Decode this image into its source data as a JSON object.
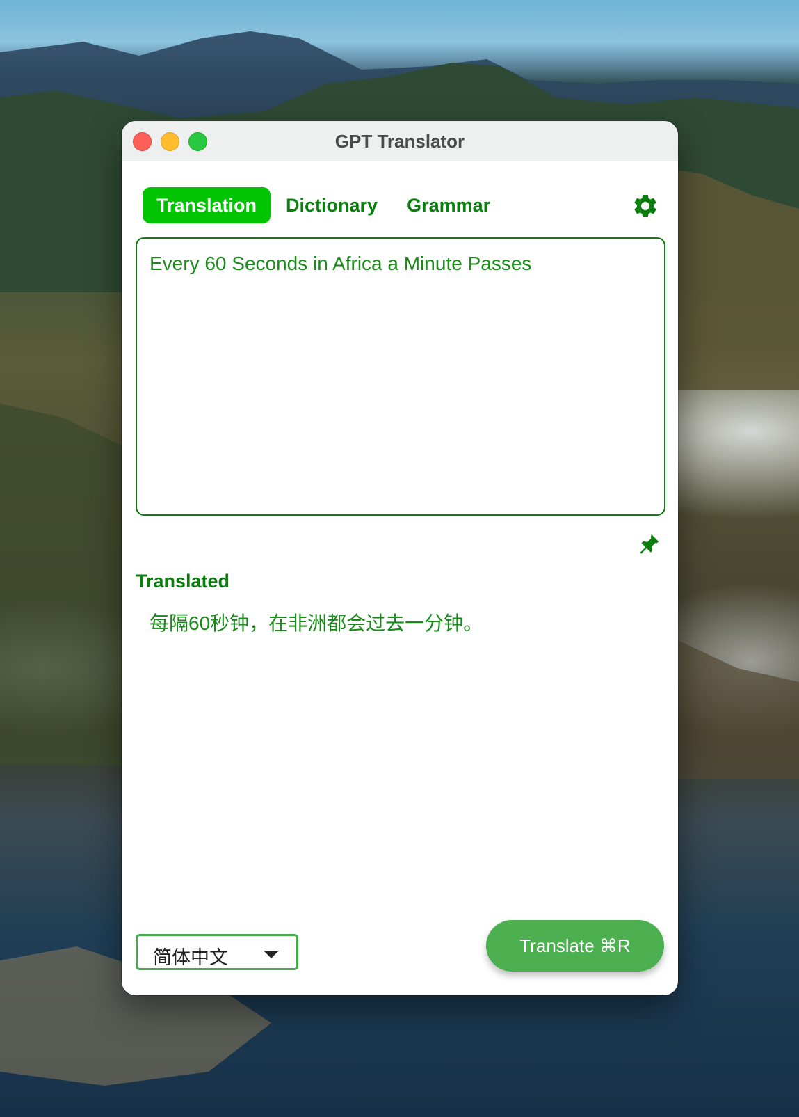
{
  "window": {
    "title": "GPT Translator"
  },
  "tabs": [
    {
      "label": "Translation",
      "active": true
    },
    {
      "label": "Dictionary",
      "active": false
    },
    {
      "label": "Grammar",
      "active": false
    }
  ],
  "source": {
    "text": "Every 60 Seconds in Africa a Minute Passes"
  },
  "result": {
    "label": "Translated",
    "text": "每隔60秒钟，在非洲都会过去一分钟。"
  },
  "language": {
    "selected": "简体中文"
  },
  "actions": {
    "translate_label": "Translate ⌘R"
  },
  "icons": {
    "settings": "gear-icon",
    "pin": "pin-icon",
    "dropdown": "caret-down-icon"
  },
  "colors": {
    "accent": "#0c7e10",
    "active_tab": "#03c403",
    "button": "#4caf50"
  }
}
